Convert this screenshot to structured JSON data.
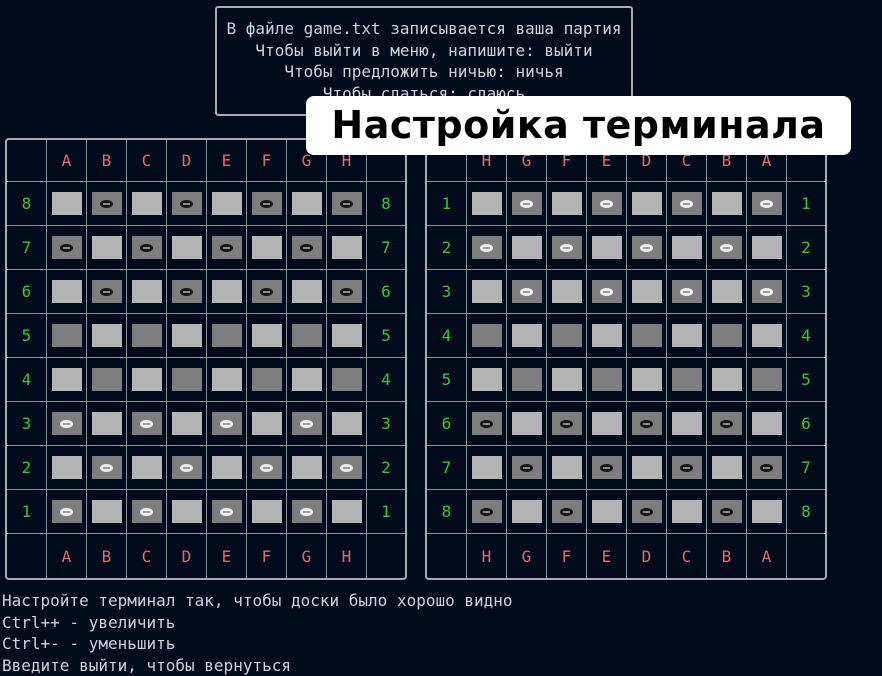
{
  "info": {
    "lines": [
      "В файле game.txt записывается ваша партия",
      "Чтобы выйти в меню, напишите: выйти",
      "Чтобы предложить ничью: ничья",
      "Чтобы сдаться: сдаюсь"
    ]
  },
  "overlay_title": "Настройка терминала",
  "boards": {
    "left": {
      "columns": [
        "A",
        "B",
        "C",
        "D",
        "E",
        "F",
        "G",
        "H"
      ],
      "rows": [
        "8",
        "7",
        "6",
        "5",
        "4",
        "3",
        "2",
        "1"
      ],
      "cells": [
        [
          "",
          "black",
          "",
          "black",
          "",
          "black",
          "",
          "black"
        ],
        [
          "black",
          "",
          "black",
          "",
          "black",
          "",
          "black",
          ""
        ],
        [
          "",
          "black",
          "",
          "black",
          "",
          "black",
          "",
          "black"
        ],
        [
          "",
          "",
          "",
          "",
          "",
          "",
          "",
          ""
        ],
        [
          "",
          "",
          "",
          "",
          "",
          "",
          "",
          ""
        ],
        [
          "white",
          "",
          "white",
          "",
          "white",
          "",
          "white",
          ""
        ],
        [
          "",
          "white",
          "",
          "white",
          "",
          "white",
          "",
          "white"
        ],
        [
          "white",
          "",
          "white",
          "",
          "white",
          "",
          "white",
          ""
        ]
      ]
    },
    "right": {
      "columns": [
        "H",
        "G",
        "F",
        "E",
        "D",
        "C",
        "B",
        "A"
      ],
      "rows": [
        "1",
        "2",
        "3",
        "4",
        "5",
        "6",
        "7",
        "8"
      ],
      "cells": [
        [
          "",
          "white",
          "",
          "white",
          "",
          "white",
          "",
          "white"
        ],
        [
          "white",
          "",
          "white",
          "",
          "white",
          "",
          "white",
          ""
        ],
        [
          "",
          "white",
          "",
          "white",
          "",
          "white",
          "",
          "white"
        ],
        [
          "",
          "",
          "",
          "",
          "",
          "",
          "",
          ""
        ],
        [
          "",
          "",
          "",
          "",
          "",
          "",
          "",
          ""
        ],
        [
          "black",
          "",
          "black",
          "",
          "black",
          "",
          "black",
          ""
        ],
        [
          "",
          "black",
          "",
          "black",
          "",
          "black",
          "",
          "black"
        ],
        [
          "black",
          "",
          "black",
          "",
          "black",
          "",
          "black",
          ""
        ]
      ]
    }
  },
  "bottom": {
    "lines": [
      "Настройте терминал так, чтобы доски было хорошо видно",
      "Ctrl++ - увеличить",
      "Ctrl+- - уменьшить",
      "Введите выйти, чтобы вернуться"
    ]
  },
  "colors": {
    "background": "#020b1c",
    "column_label": "#e46b6b",
    "row_label": "#38c838",
    "light_square": "#b4b4b4",
    "dark_square": "#7d7d7d"
  }
}
